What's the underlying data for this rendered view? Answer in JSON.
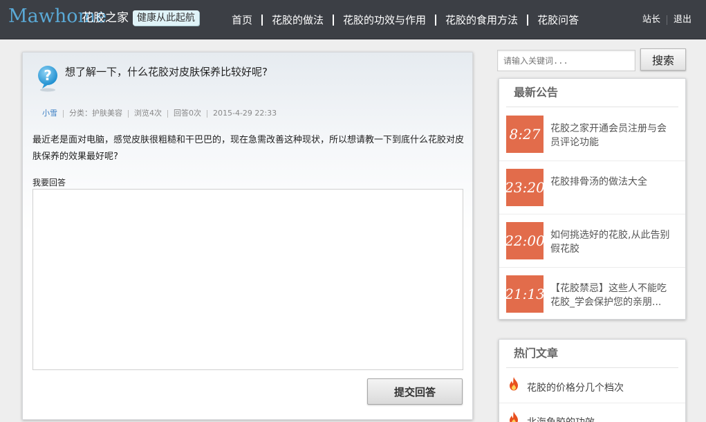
{
  "header": {
    "logo_en": "Mawhome",
    "logo_cn": "花胶之家",
    "slogan": "健康从此起航",
    "nav": [
      {
        "label": "首页"
      },
      {
        "label": "花胶的做法"
      },
      {
        "label": "花胶的功效与作用"
      },
      {
        "label": "花胶的食用方法"
      },
      {
        "label": "花胶问答"
      }
    ],
    "links": [
      {
        "label": "站长"
      },
      {
        "label": "退出"
      }
    ]
  },
  "question": {
    "title": "想了解一下，什么花胶对皮肤保养比较好呢?",
    "user": "小雪",
    "category": "分类：护肤美容",
    "views": "浏览4次",
    "answers": "回答0次",
    "date": "2015-4-29 22:33",
    "body": "最近老是面对电脑，感觉皮肤很粗糙和干巴巴的，现在急需改善这种现状，所以想请教一下到底什么花胶对皮肤保养的效果最好呢?",
    "answer_label": "我要回答",
    "answer_value": "",
    "submit_label": "提交回答"
  },
  "search": {
    "placeholder": "请输入关键词...",
    "button_label": "搜索"
  },
  "notice": {
    "title": "最新公告",
    "items": [
      {
        "time": "8:27",
        "text": "花胶之家开通会员注册与会员评论功能"
      },
      {
        "time": "23:20",
        "text": "花胶排骨汤的做法大全"
      },
      {
        "time": "22:00",
        "text": "如何挑选好的花胶,从此告别假花胶"
      },
      {
        "time": "21:13",
        "text": "【花胶禁忌】这些人不能吃花胶_学会保护您的亲朋..."
      }
    ]
  },
  "hot": {
    "title": "热门文章",
    "items": [
      {
        "text": "花胶的价格分几个档次"
      },
      {
        "text": "北海鱼胶的功效"
      }
    ]
  },
  "colors": {
    "header_bg": "#3c3f45",
    "logo_en": "#5aa9d6",
    "time_badge": "#e26c4b",
    "user_link": "#3b7fc4",
    "fire": "#e8501e"
  }
}
